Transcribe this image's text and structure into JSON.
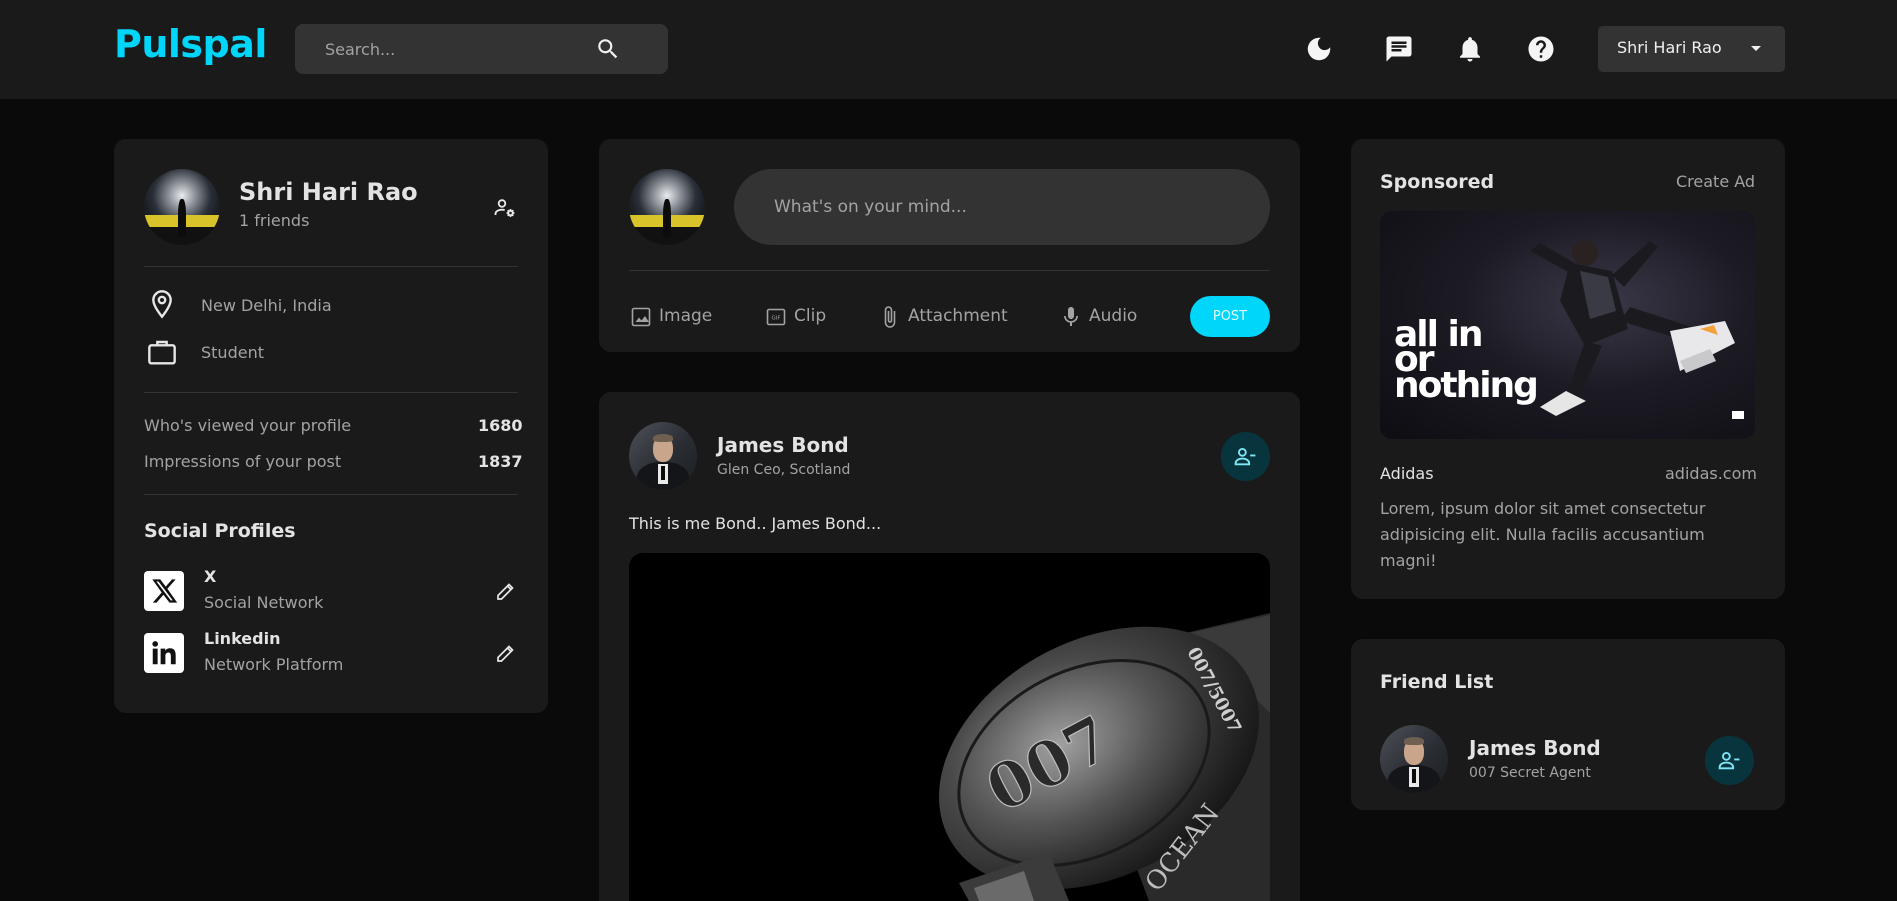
{
  "app": {
    "logo": "Pulspal"
  },
  "navbar": {
    "search_placeholder": "Search...",
    "user_name": "Shri Hari Rao",
    "icons": [
      "moon-icon",
      "chat-icon",
      "bell-icon",
      "help-icon",
      "caret-down-icon"
    ]
  },
  "profile": {
    "name": "Shri Hari Rao",
    "friends": "1 friends",
    "location": "New Delhi, India",
    "occupation": "Student",
    "stats": [
      {
        "label": "Who's viewed your profile",
        "value": "1680"
      },
      {
        "label": "Impressions of your post",
        "value": "1837"
      }
    ],
    "social_title": "Social Profiles",
    "socials": [
      {
        "name": "X",
        "type": "Social Network"
      },
      {
        "name": "Linkedin",
        "type": "Network Platform"
      }
    ]
  },
  "composer": {
    "placeholder": "What's on your mind...",
    "actions": [
      "Image",
      "Clip",
      "Attachment",
      "Audio"
    ],
    "post_label": "POST"
  },
  "post": {
    "author": "James Bond",
    "location": "Glen Ceo, Scotland",
    "text": "This is me Bond.. James Bond...",
    "image_text": [
      "007",
      "007/5007",
      "OCEAN"
    ]
  },
  "sponsored": {
    "title": "Sponsored",
    "create_ad": "Create Ad",
    "ad_lines": [
      "all in",
      "or",
      "nothing"
    ],
    "brand": "Adidas",
    "url": "adidas.com",
    "description": "Lorem, ipsum dolor sit amet consectetur adipisicing elit. Nulla facilis accusantium magni!"
  },
  "friend_list": {
    "title": "Friend List",
    "friends": [
      {
        "name": "James Bond",
        "subtitle": "007 Secret Agent"
      }
    ]
  },
  "colors": {
    "accent": "#00d5fa",
    "background": "#0a0a0a",
    "card": "#1a1a1a",
    "input": "#333333",
    "muted_text": "#a3a3a3",
    "friend_button": "#08353d"
  }
}
